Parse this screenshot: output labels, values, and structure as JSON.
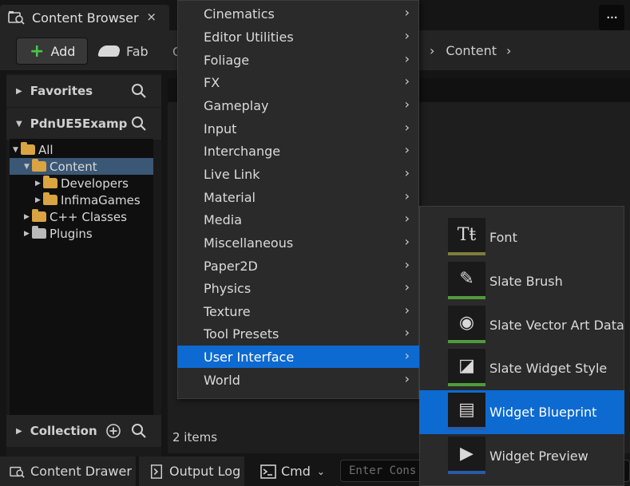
{
  "tab": {
    "title": "Content Browser",
    "close": "×"
  },
  "more_button": "···",
  "toolbar": {
    "add_label": "Add",
    "fab_label": "Fab",
    "cut_text": "C",
    "breadcrumb": "Content"
  },
  "left_panel": {
    "favorites": "Favorites",
    "project": "PdnUE5Examp",
    "collection": "Collection",
    "tree": [
      {
        "label": "All",
        "level": 0,
        "expanded": true
      },
      {
        "label": "Content",
        "level": 1,
        "expanded": true,
        "selected": true
      },
      {
        "label": "Developers",
        "level": 2,
        "expanded": false
      },
      {
        "label": "InfimaGames",
        "level": 2,
        "expanded": false
      },
      {
        "label": "C++ Classes",
        "level": 1,
        "expanded": false
      },
      {
        "label": "Plugins",
        "level": 1,
        "expanded": false
      }
    ]
  },
  "main": {
    "items_count": "2 items"
  },
  "statusbar": {
    "content_drawer": "Content Drawer",
    "output_log": "Output Log",
    "cmd": "Cmd",
    "cmd_placeholder": "Enter Cons"
  },
  "menu": {
    "items": [
      "Cinematics",
      "Editor Utilities",
      "Foliage",
      "FX",
      "Gameplay",
      "Input",
      "Interchange",
      "Live Link",
      "Material",
      "Media",
      "Miscellaneous",
      "Paper2D",
      "Physics",
      "Texture",
      "Tool Presets",
      "User Interface",
      "World"
    ],
    "active_index": 15
  },
  "submenu": {
    "items": [
      {
        "label": "Font",
        "icon": "font-icon",
        "color": "#7d7d3d"
      },
      {
        "label": "Slate Brush",
        "icon": "slate-brush-icon",
        "color": "#4f9b3a"
      },
      {
        "label": "Slate Vector Art Data",
        "icon": "vector-art-icon",
        "color": "#4f9b3a"
      },
      {
        "label": "Slate Widget Style",
        "icon": "widget-style-icon",
        "color": "#4f9b3a"
      },
      {
        "label": "Widget Blueprint",
        "icon": "widget-blueprint-icon",
        "color": "#2a5aa8"
      },
      {
        "label": "Widget Preview",
        "icon": "widget-preview-icon",
        "color": "#2a5aa8"
      }
    ],
    "active_index": 4
  },
  "colors": {
    "accent": "#0d6ad1",
    "selection": "#3a5875",
    "folder": "#d9a441"
  }
}
